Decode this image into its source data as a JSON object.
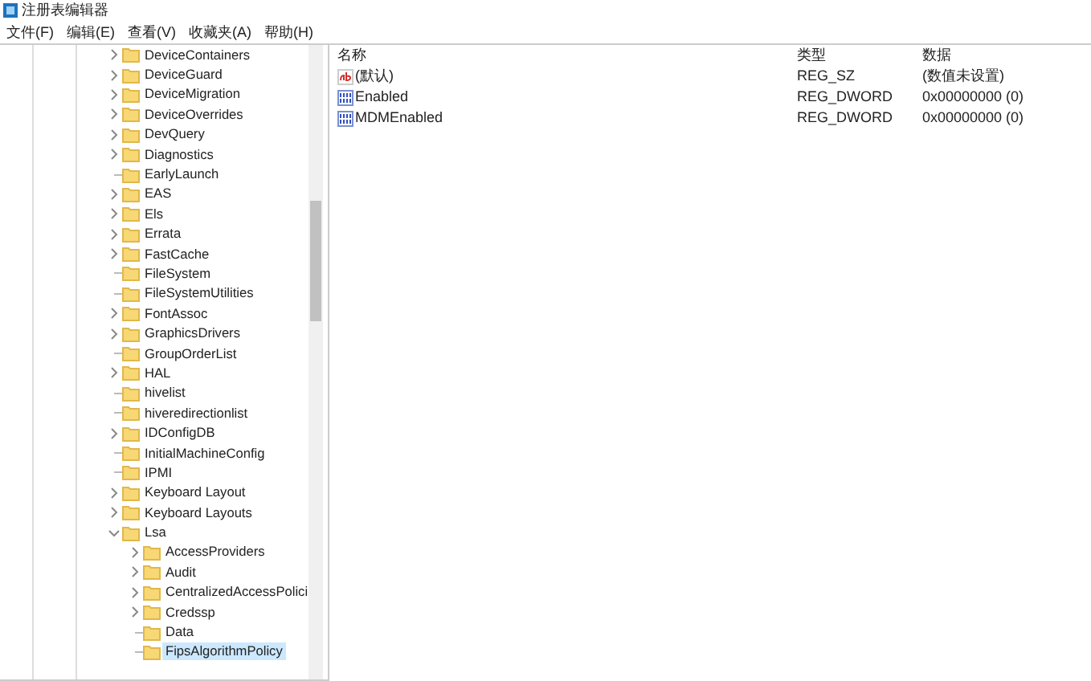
{
  "window": {
    "title": "注册表编辑器"
  },
  "menu": [
    "文件(F)",
    "编辑(E)",
    "查看(V)",
    "收藏夹(A)",
    "帮助(H)"
  ],
  "tree": [
    {
      "label": "DeviceContainers",
      "expanded": false,
      "selected": false
    },
    {
      "label": "DeviceGuard",
      "expanded": false,
      "selected": false
    },
    {
      "label": "DeviceMigration",
      "expanded": false,
      "selected": false
    },
    {
      "label": "DeviceOverrides",
      "expanded": false,
      "selected": false
    },
    {
      "label": "DevQuery",
      "expanded": false,
      "selected": false
    },
    {
      "label": "Diagnostics",
      "expanded": false,
      "selected": false
    },
    {
      "label": "EarlyLaunch",
      "selected": false
    },
    {
      "label": "EAS",
      "expanded": false,
      "selected": false
    },
    {
      "label": "Els",
      "expanded": false,
      "selected": false
    },
    {
      "label": "Errata",
      "expanded": false,
      "selected": false
    },
    {
      "label": "FastCache",
      "expanded": false,
      "selected": false
    },
    {
      "label": "FileSystem",
      "selected": false
    },
    {
      "label": "FileSystemUtilities",
      "selected": false
    },
    {
      "label": "FontAssoc",
      "expanded": false,
      "selected": false
    },
    {
      "label": "GraphicsDrivers",
      "expanded": false,
      "selected": false
    },
    {
      "label": "GroupOrderList",
      "selected": false
    },
    {
      "label": "HAL",
      "expanded": false,
      "selected": false
    },
    {
      "label": "hivelist",
      "selected": false
    },
    {
      "label": "hiveredirectionlist",
      "selected": false
    },
    {
      "label": "IDConfigDB",
      "expanded": false,
      "selected": false
    },
    {
      "label": "InitialMachineConfig",
      "selected": false
    },
    {
      "label": "IPMI",
      "selected": false
    },
    {
      "label": "Keyboard Layout",
      "expanded": false,
      "selected": false
    },
    {
      "label": "Keyboard Layouts",
      "expanded": false,
      "selected": false
    },
    {
      "label": "Lsa",
      "expanded": true,
      "selected": false,
      "children": [
        {
          "label": "AccessProviders",
          "expanded": false,
          "selected": false
        },
        {
          "label": "Audit",
          "expanded": false,
          "selected": false
        },
        {
          "label": "CentralizedAccessPolici",
          "expanded": false,
          "selected": false
        },
        {
          "label": "Credssp",
          "expanded": false,
          "selected": false
        },
        {
          "label": "Data",
          "selected": false
        },
        {
          "label": "FipsAlgorithmPolicy",
          "selected": true
        }
      ]
    }
  ],
  "values": {
    "columns": [
      "名称",
      "类型",
      "数据"
    ],
    "rows": [
      {
        "kind": "string",
        "name": "(默认)",
        "type": "REG_SZ",
        "data": "(数值未设置)"
      },
      {
        "kind": "dword",
        "name": "Enabled",
        "type": "REG_DWORD",
        "data": "0x00000000 (0)"
      },
      {
        "kind": "dword",
        "name": "MDMEnabled",
        "type": "REG_DWORD",
        "data": "0x00000000 (0)"
      }
    ]
  }
}
